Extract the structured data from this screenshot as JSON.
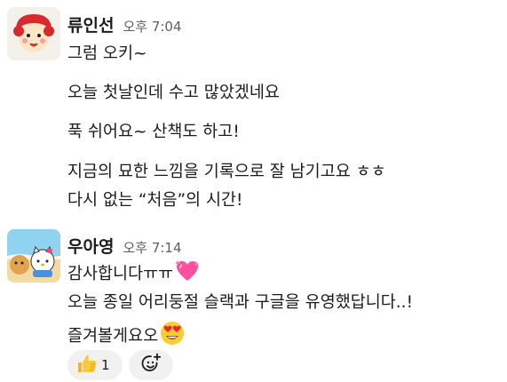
{
  "messages": [
    {
      "author": "류인선",
      "time": "오후 7:04",
      "lines": [
        "그럼 오키~",
        "오늘 첫날인데 수고 많았겠네요",
        "푹 쉬어요~ 산책도 하고!",
        "지금의 묘한 느낌을 기록으로 잘 남기고요 ㅎㅎ",
        "다시 없는 “처음”의 시간!"
      ]
    },
    {
      "author": "우아영",
      "time": "오후 7:14",
      "lines": [
        "감사합니다ㅠㅠ",
        "오늘 종일 어리둥절 슬랙과 구글을 유영했답니다..!",
        "즐겨볼게요오"
      ],
      "reactions": [
        {
          "icon": "thumbs-up",
          "count": "1"
        },
        {
          "icon": "add-reaction"
        }
      ]
    }
  ]
}
